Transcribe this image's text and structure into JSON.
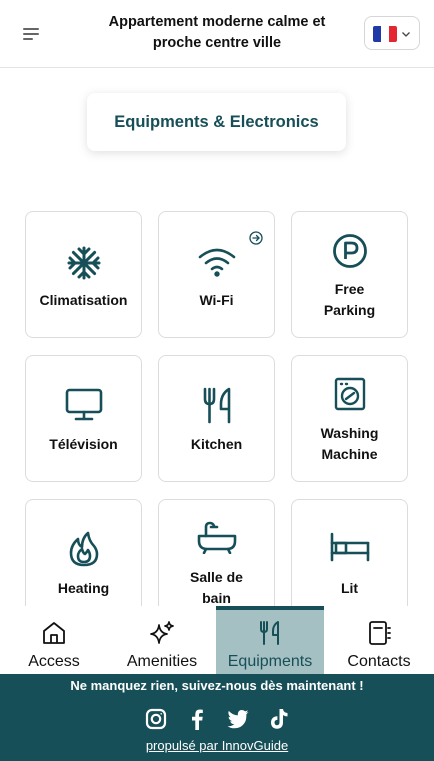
{
  "header": {
    "title_line1": "Appartement moderne calme et",
    "title_line2": "proche centre ville",
    "language_flag": [
      "#1f3aa6",
      "#ffffff",
      "#e3262f"
    ]
  },
  "section": {
    "title": "Equipments & Electronics"
  },
  "tiles": [
    {
      "label": "Climatisation",
      "icon": "snowflake-icon"
    },
    {
      "label": "Wi-Fi",
      "icon": "wifi-icon",
      "extra_icon": "arrow-right-circle-icon"
    },
    {
      "label_line1": "Free",
      "label_line2": "Parking",
      "icon": "parking-icon"
    },
    {
      "label": "Télévision",
      "icon": "monitor-icon"
    },
    {
      "label": "Kitchen",
      "icon": "utensils-icon"
    },
    {
      "label_line1": "Washing",
      "label_line2": "Machine",
      "icon": "washing-machine-icon"
    },
    {
      "label": "Heating",
      "icon": "flame-icon"
    },
    {
      "label_line1": "Salle de",
      "label_line2": "bain",
      "icon": "bathtub-icon"
    },
    {
      "label": "Lit",
      "icon": "bed-icon"
    }
  ],
  "nav": {
    "tabs": [
      {
        "label": "Access",
        "icon": "home-icon"
      },
      {
        "label": "Amenities",
        "icon": "sparkles-icon"
      },
      {
        "label": "Equipments",
        "icon": "utensils-icon",
        "active": true
      },
      {
        "label": "Contacts",
        "icon": "notebook-icon"
      }
    ]
  },
  "footer": {
    "message": "Ne manquez rien, suivez-nous dès maintenant !",
    "socials": [
      "instagram-icon",
      "facebook-icon",
      "twitter-icon",
      "tiktok-icon"
    ],
    "powered_by": "propulsé par InnovGuide"
  },
  "colors": {
    "brand": "#174f58",
    "active_tab_bg": "#a4c0c3",
    "border": "#dcdcdc"
  }
}
